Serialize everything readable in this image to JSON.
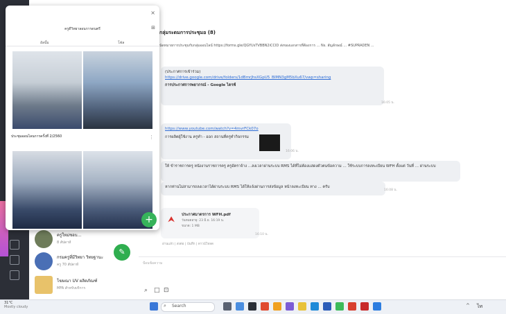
{
  "popup": {
    "title": "ครูดีวิทยาลอนการดนตรี",
    "tabs": [
      "อัลบั้ม",
      "โฟล"
    ],
    "album2_title": "ประชุมออนไลนการครั้งที่ 2/2560"
  },
  "chat": {
    "title": "กลุ่มระดมการประชุมอ (8)",
    "announcement": "นัดหมายการประชุมกับกลุ่มออนไลน์ https://forms.gle/QGYUsTVBBN2iCCID ส่งของเอกสารที่ต้องการ ... Ns. สัญลักษณ์ ... #SUPRADEN ...",
    "msg1_line1": "(ประกาศการเข้าร่วม)",
    "msg1_link": "https://drive.google.com/drive/folders/1dBmrJhsXGpU5_BIMN3gM5bXu67/vwp=sharing",
    "msg1_card_title": "การประกาศการพยากรณ์ - Google ไดรฟ์",
    "msg1_time": "16:05 น.",
    "msg2_link": "https://www.youtube.com/watch?v=4mvrFCk07o",
    "msg2_card_title": "การผลิตผู้ใช้งาน ครูทำ - ออก สถานที่ครูทำกิจกรรม",
    "msg2_time": "16:06 น.",
    "msg3": "ให้ ข้าราชการครู หนังงานราชการครู ครูอัตราจ้าง ...ลงเวลาผ่านระบบ RMS ได้ที่ไม่ต้องแสดงตัวตนข้อความ ... ใช้ระบบการลงทะเบียน WFH ตั้งแต่ วันที่ ... ผ่านระบบ",
    "msg4": "หากท่านไม่สามารถลงเวลาได้ผ่านระบบ RMS ได้ให้แจ้งผ่านการส่งข้อมูล หน้าลงทะเบียน ทาง ... ครับ",
    "msg4_time": "16:08 น.",
    "file_name": "ประกาศมาตรการ WFH.pdf",
    "file_meta": "วันหมดอายุ: 23 มิ.ย. 16:19 น.",
    "file_size": "ขนาด: 1 MB",
    "file_footer": "อ่านแล้ว | ส่งต่อ | บันทึก | ดาวน์โหลด",
    "file_time": "16:10 น.",
    "composer_placeholder": "ป้อนข้อความ"
  },
  "list": {
    "items": [
      {
        "name": "ครูใหม่ชอบ...",
        "sub": "8 สัปดาห์"
      },
      {
        "name": "กรมครูที่มีวิทยา วิทยฐานะ",
        "sub": "ครู 70 สัปดาห์"
      },
      {
        "name": "โฆษณา UV ผลิตภัณฑ์",
        "sub": "MFA สำหรับบริการ"
      }
    ]
  },
  "taskbar": {
    "weather_temp": "31°C",
    "weather_label": "Mostly cloudy",
    "search_label": "Search",
    "clock": "ไท"
  }
}
